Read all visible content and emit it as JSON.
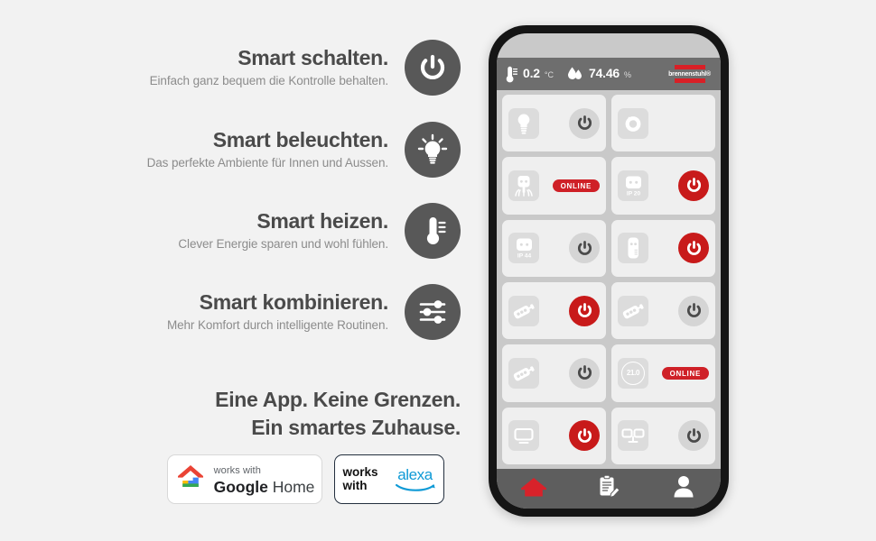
{
  "features": [
    {
      "title": "Smart schalten.",
      "subtitle": "Einfach ganz bequem die Kontrolle behalten.",
      "icon": "power-icon"
    },
    {
      "title": "Smart beleuchten.",
      "subtitle": "Das perfekte Ambiente für Innen und Aussen.",
      "icon": "lightbulb-icon"
    },
    {
      "title": "Smart heizen.",
      "subtitle": "Clever Energie sparen und wohl fühlen.",
      "icon": "thermometer-icon"
    },
    {
      "title": "Smart kombinieren.",
      "subtitle": "Mehr Komfort durch intelligente Routinen.",
      "icon": "sliders-icon"
    }
  ],
  "tagline": {
    "line1": "Eine App. Keine Grenzen.",
    "line2": "Ein smartes Zuhause."
  },
  "badges": {
    "google": {
      "works_with": "works with",
      "brand_bold": "Google",
      "brand_light": "Home",
      "icon": "google-home-icon"
    },
    "alexa": {
      "works_line1": "works",
      "works_line2": "with",
      "brand": "alexa",
      "icon": "alexa-smile-icon"
    }
  },
  "phone": {
    "statusbar": {
      "temperature": {
        "icon": "thermometer-icon",
        "value": "0.2",
        "unit": "°C"
      },
      "humidity": {
        "icon": "water-drop-icon",
        "value": "74.46",
        "unit": "%"
      },
      "brand": "brennenstuhl®"
    },
    "rows": [
      [
        {
          "device_icon": "light-bulb-icon",
          "control": "power-button",
          "state": "off"
        },
        {
          "device_icon": "round-sensor-icon",
          "control": "none",
          "state": "none"
        }
      ],
      [
        {
          "device_icon": "garden-socket-icon",
          "control": "status-badge",
          "badge": "ONLINE",
          "state": "online"
        },
        {
          "device_icon": "socket-ip20-icon",
          "device_label": "IP 20",
          "control": "power-button",
          "state": "on"
        }
      ],
      [
        {
          "device_icon": "socket-ip44-icon",
          "device_label": "IP 44",
          "control": "power-button",
          "state": "off"
        },
        {
          "device_icon": "plug-adapter-icon",
          "control": "power-button",
          "state": "on"
        }
      ],
      [
        {
          "device_icon": "power-strip-icon",
          "control": "power-button",
          "state": "on"
        },
        {
          "device_icon": "power-strip-icon",
          "control": "power-button",
          "state": "off"
        }
      ],
      [
        {
          "device_icon": "power-strip-icon",
          "control": "power-button",
          "state": "off"
        },
        {
          "device_icon": "thermostat-icon",
          "device_label": "21.0",
          "control": "status-badge",
          "badge": "ONLINE",
          "state": "online"
        }
      ],
      [
        {
          "device_icon": "monitor-icon",
          "control": "power-button",
          "state": "on"
        },
        {
          "device_icon": "dual-monitor-icon",
          "control": "power-button",
          "state": "off"
        }
      ]
    ],
    "navbar": [
      {
        "icon": "home-icon",
        "active": true
      },
      {
        "icon": "clipboard-notes-icon",
        "active": false
      },
      {
        "icon": "profile-person-icon",
        "active": false
      }
    ]
  },
  "colors": {
    "accent_red": "#cf2027",
    "power_on_red": "#c81a1a",
    "icon_circle_gray": "#585858",
    "background": "#f2f2f2",
    "phone_frame": "#151515"
  }
}
